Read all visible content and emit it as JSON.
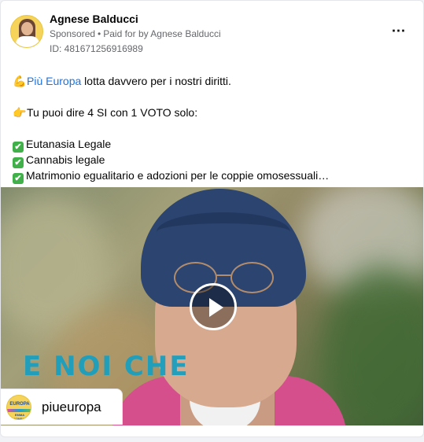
{
  "post": {
    "author": "Agnese Balducci",
    "sponsored": "Sponsored",
    "separator": "•",
    "paid_for": "Paid for by Agnese Balducci",
    "ad_id": "ID: 481671256916989",
    "more_icon": "⋯"
  },
  "body": {
    "line1_emoji": "💪",
    "line1_link": "Più Europa",
    "line1_rest": " lotta davvero per i nostri diritti.",
    "line2_emoji": "👉",
    "line2_text": "Tu puoi dire 4 SI con 1 VOTO solo:",
    "check_glyph": "✔",
    "items": [
      "Eutanasia Legale",
      "Cannabis legale",
      "Matrimonio egualitario e adozioni per le coppie omosessuali…"
    ]
  },
  "media": {
    "overlay_text": "E NOI CHE",
    "play_icon": "play-icon",
    "brand": {
      "name": "piueuropa",
      "logo_top": "EUROPA",
      "logo_bottom": "EMMA BONINO"
    }
  },
  "colors": {
    "link": "#1b74e4",
    "check": "#41b04a",
    "overlay_text": "#1a9fbf",
    "muted": "#65676b"
  }
}
